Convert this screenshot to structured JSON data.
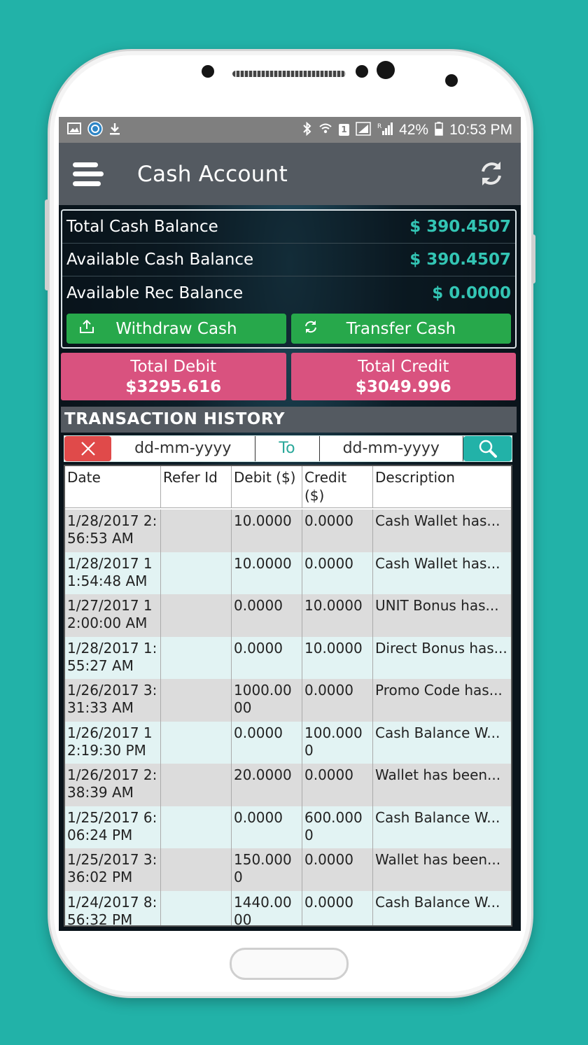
{
  "status_bar": {
    "battery": "42%",
    "time": "10:53 PM",
    "sim": "1"
  },
  "app_bar": {
    "title": "Cash Account"
  },
  "balances": [
    {
      "label": "Total Cash Balance",
      "value": "$ 390.4507"
    },
    {
      "label": "Available Cash Balance",
      "value": "$ 390.4507"
    },
    {
      "label": "Available Rec Balance",
      "value": "$ 0.0000"
    }
  ],
  "actions": {
    "withdraw": "Withdraw Cash",
    "transfer": "Transfer Cash"
  },
  "totals": {
    "debit_label": "Total Debit",
    "debit_value": "$3295.616",
    "credit_label": "Total Credit",
    "credit_value": "$3049.996"
  },
  "history": {
    "title": "TRANSACTION HISTORY",
    "from_placeholder": "dd-mm-yyyy",
    "to_label": "To",
    "to_placeholder": "dd-mm-yyyy",
    "columns": [
      "Date",
      "Refer Id",
      "Debit ($)",
      "Credit ($)",
      "Description"
    ],
    "rows": [
      {
        "date": "1/28/2017 2:56:53 AM",
        "refer": "",
        "debit": "10.0000",
        "credit": "0.0000",
        "desc": "Cash Wallet has..."
      },
      {
        "date": "1/28/2017 11:54:48 AM",
        "refer": "",
        "debit": "10.0000",
        "credit": "0.0000",
        "desc": "Cash Wallet has..."
      },
      {
        "date": "1/27/2017 12:00:00 AM",
        "refer": "",
        "debit": "0.0000",
        "credit": "10.0000",
        "desc": "UNIT Bonus has..."
      },
      {
        "date": "1/28/2017 1:55:27 AM",
        "refer": "",
        "debit": "0.0000",
        "credit": "10.0000",
        "desc": "Direct Bonus has..."
      },
      {
        "date": "1/26/2017 3:31:33 AM",
        "refer": "",
        "debit": "1000.0000",
        "credit": "0.0000",
        "desc": "Promo Code has..."
      },
      {
        "date": "1/26/2017 12:19:30 PM",
        "refer": "",
        "debit": "0.0000",
        "credit": "100.0000",
        "desc": "Cash Balance W..."
      },
      {
        "date": "1/26/2017 2:38:39 AM",
        "refer": "",
        "debit": "20.0000",
        "credit": "0.0000",
        "desc": "Wallet has been..."
      },
      {
        "date": "1/25/2017 6:06:24 PM",
        "refer": "",
        "debit": "0.0000",
        "credit": "600.0000",
        "desc": "Cash Balance W..."
      },
      {
        "date": "1/25/2017 3:36:02 PM",
        "refer": "",
        "debit": "150.0000",
        "credit": "0.0000",
        "desc": "Wallet has been..."
      },
      {
        "date": "1/24/2017 8:56:32 PM",
        "refer": "",
        "debit": "1440.0000",
        "credit": "0.0000",
        "desc": "Cash Balance W..."
      }
    ]
  },
  "colors": {
    "background": "#22b2a8",
    "app_bar": "#545a61",
    "accent_teal": "#33c5b4",
    "button_green": "#27a84b",
    "total_pink": "#d9527f",
    "clear_red": "#e04a4a"
  }
}
